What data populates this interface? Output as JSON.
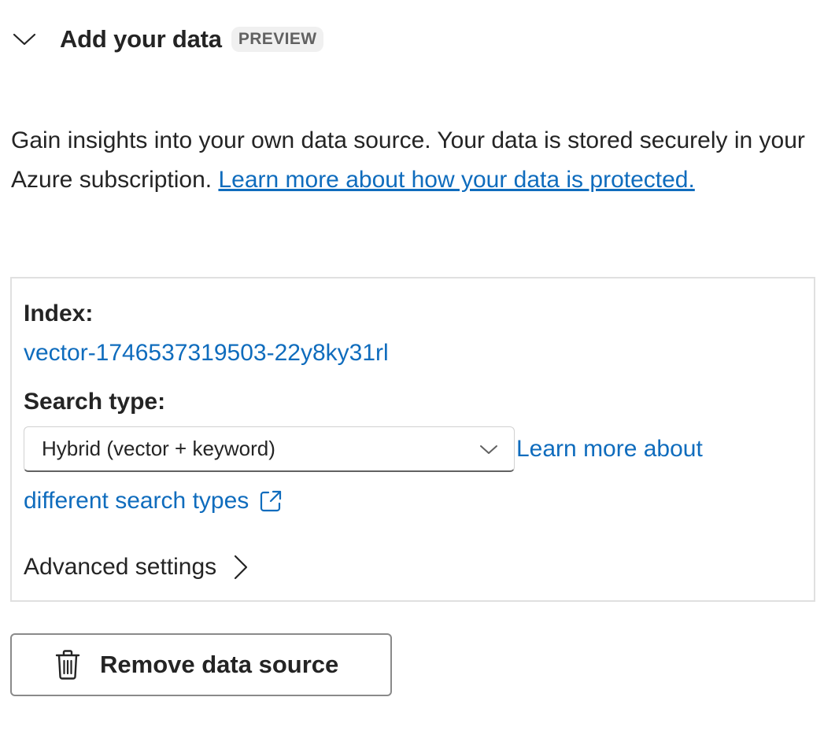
{
  "section": {
    "title": "Add your data",
    "badge": "PREVIEW"
  },
  "description": {
    "text": "Gain insights into your own data source. Your data is stored securely in your Azure subscription. ",
    "link": "Learn more about how your data is protected."
  },
  "panel": {
    "index_label": "Index:",
    "index_value": "vector-1746537319503-22y8ky31rl",
    "search_type_label": "Search type:",
    "search_type_value": "Hybrid (vector + keyword)",
    "learn_more_line1": "Learn more about",
    "learn_more_line2": "different search types",
    "advanced_settings": "Advanced settings"
  },
  "actions": {
    "remove_label": "Remove data source"
  },
  "colors": {
    "link": "#0f6cbd",
    "text": "#242424",
    "badge_bg": "#f0f0f0"
  },
  "icons": {
    "collapse": "chevron-down-icon",
    "dropdown": "chevron-down-icon",
    "external": "external-link-icon",
    "advanced": "chevron-right-icon",
    "remove": "trash-icon"
  }
}
